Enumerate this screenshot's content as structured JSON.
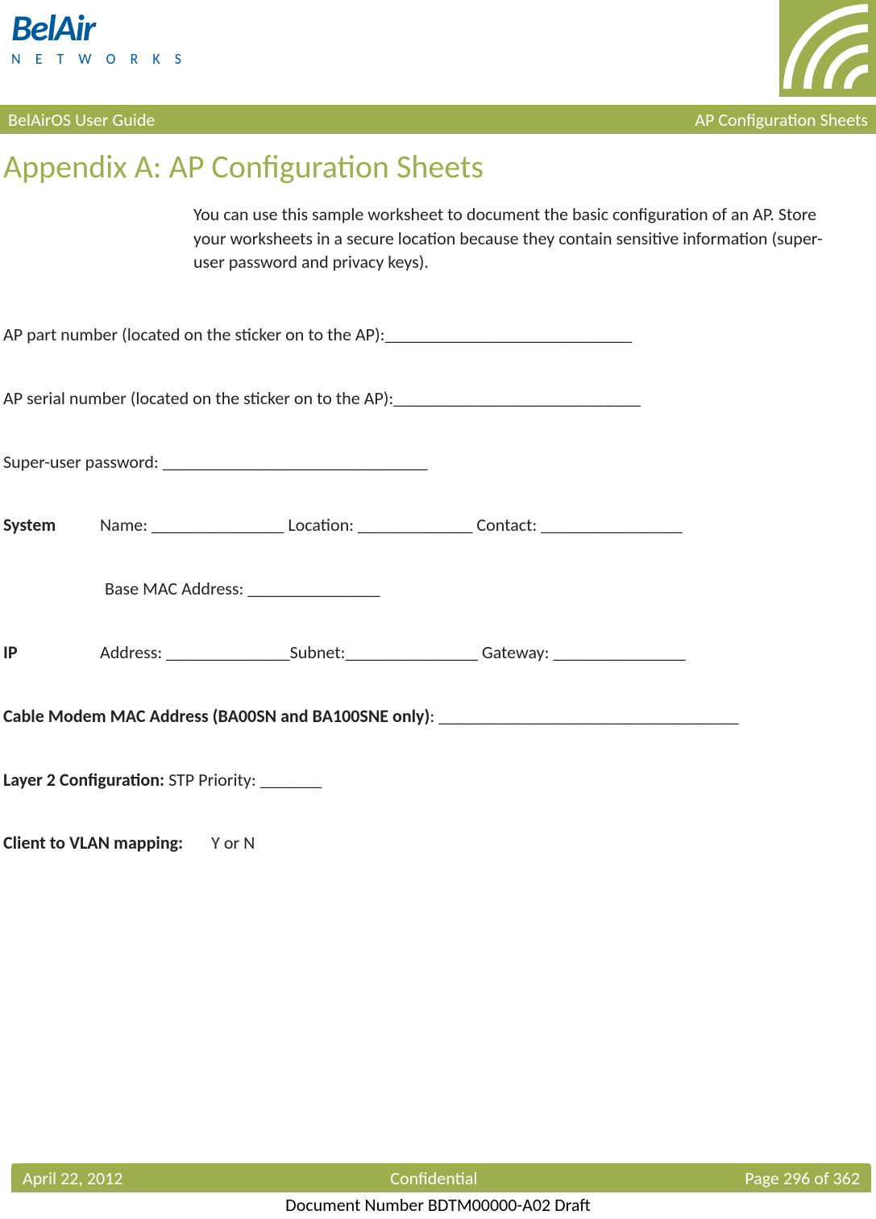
{
  "logo": {
    "line1": "BelAir",
    "line2": "N E T W O R K S"
  },
  "banner": {
    "left": "BelAirOS User Guide",
    "right": "AP Configuration Sheets"
  },
  "title": "Appendix A: AP Configuration Sheets",
  "intro": "You can use this sample worksheet to document the basic configuration of an AP. Store your worksheets in a secure location because they contain sensitive information (super-user password and privacy keys).",
  "lines": {
    "ap_part": "AP part number (located on the sticker on to the AP):____________________________",
    "ap_serial": "AP serial number (located on the sticker on to the AP):____________________________",
    "super_pwd": "Super-user password: ______________________________",
    "system_label": "System",
    "system_row": "Name: _______________ Location: _____________ Contact: ________________",
    "base_mac": "Base MAC Address: _______________",
    "ip_label": "IP",
    "ip_row": "Address: ______________Subnet:_______________ Gateway: _______________",
    "cable_label": "Cable Modem MAC Address (BA00SN and BA100SNE only)",
    "cable_line": ": __________________________________",
    "layer2_label": "Layer 2 Configuration:",
    "layer2_rest": " STP Priority: _______",
    "vlan_label": "Client to VLAN mapping:",
    "vlan_rest": "Y or N"
  },
  "footer": {
    "left": "April 22, 2012",
    "center": "Confidential",
    "right": "Page 296 of 362",
    "doc": "Document Number BDTM00000-A02 Draft"
  }
}
